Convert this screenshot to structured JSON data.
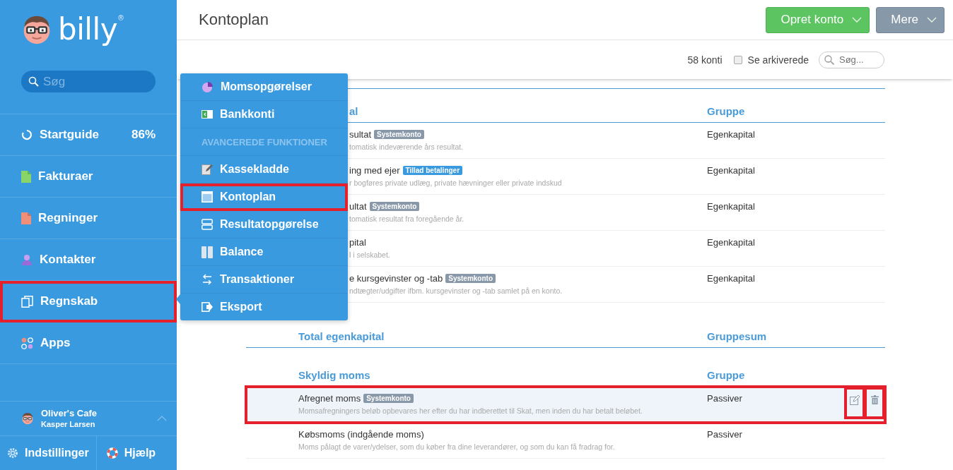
{
  "sidebar": {
    "logo": "billy",
    "logo_mark": "®",
    "search": {
      "placeholder": "Søg"
    },
    "items": [
      {
        "label": "Startguide",
        "badge": "86%",
        "highlighted": false
      },
      {
        "label": "Fakturaer",
        "highlighted": false
      },
      {
        "label": "Regninger",
        "highlighted": false
      },
      {
        "label": "Kontakter",
        "highlighted": false
      },
      {
        "label": "Regnskab",
        "highlighted": true
      },
      {
        "label": "Apps",
        "highlighted": false
      }
    ],
    "company": {
      "name": "Oliver's Cafe",
      "user": "Kasper Larsen"
    },
    "footer": [
      {
        "label": "Indstillinger"
      },
      {
        "label": "Hjælp"
      }
    ]
  },
  "flyout": {
    "items": [
      {
        "kind": "link",
        "label": "Momsopgørelser",
        "highlighted": false
      },
      {
        "kind": "link",
        "label": "Bankkonti",
        "highlighted": false
      },
      {
        "kind": "header",
        "label": "AVANCEREDE FUNKTIONER",
        "highlighted": false
      },
      {
        "kind": "link",
        "label": "Kassekladde",
        "highlighted": false
      },
      {
        "kind": "link",
        "label": "Kontoplan",
        "highlighted": true
      },
      {
        "kind": "link",
        "label": "Resultatopgørelse",
        "highlighted": false
      },
      {
        "kind": "link",
        "label": "Balance",
        "highlighted": false
      },
      {
        "kind": "link",
        "label": "Transaktioner",
        "highlighted": false
      },
      {
        "kind": "link",
        "label": "Eksport",
        "highlighted": false
      }
    ]
  },
  "header": {
    "title": "Kontoplan",
    "buttons": [
      {
        "label": "Opret konto",
        "kind": "primary"
      },
      {
        "label": "Mere",
        "kind": "secondary"
      }
    ]
  },
  "toolbar": {
    "count": "58 konti",
    "archived": {
      "label": "Se arkiverede",
      "checked": false
    },
    "search": {
      "placeholder": "Søg..."
    }
  },
  "sections": [
    {
      "kind": "group",
      "title": "al",
      "group_heading": "Gruppe",
      "rows": [
        {
          "name": "sultat",
          "tag": {
            "label": "Systemkonto",
            "kind": "system"
          },
          "description": "tomatisk indeværende års resultat.",
          "group": "Egenkapital",
          "hovered": false,
          "highlighted": false
        },
        {
          "name": "ing med ejer",
          "tag": {
            "label": "Tillad betalinger",
            "kind": "payment"
          },
          "description": "r bogføres private udlæg, private hævninger eller private indskud",
          "group": "Egenkapital",
          "hovered": false,
          "highlighted": false
        },
        {
          "name": "ultat",
          "tag": {
            "label": "Systemkonto",
            "kind": "system"
          },
          "description": "tomatisk resultat fra foregående år.",
          "group": "Egenkapital",
          "hovered": false,
          "highlighted": false
        },
        {
          "name": "pital",
          "description": "l i selskabet.",
          "group": "Egenkapital",
          "hovered": false,
          "highlighted": false
        },
        {
          "name": "e kursgevinster og -tab",
          "tag": {
            "label": "Systemkonto",
            "kind": "system"
          },
          "description": "ndtægter/udgifter ifbm. kursgevinster og -tab samlet på en konto.",
          "group": "Egenkapital",
          "hovered": false,
          "highlighted": false
        }
      ]
    },
    {
      "kind": "total",
      "title": "Total egenkapital",
      "group_heading": "Gruppesum"
    },
    {
      "kind": "group",
      "title": "Skyldig moms",
      "group_heading": "Gruppe",
      "rows": [
        {
          "name": "Afregnet moms",
          "tag": {
            "label": "Systemkonto",
            "kind": "system"
          },
          "description": "Momsafregningers beløb opbevares her efter du har indberettet til Skat, men inden du har betalt beløbet.",
          "group": "Passiver",
          "hovered": true,
          "highlighted": true,
          "actions": [
            {
              "kind": "edit",
              "highlighted": true
            },
            {
              "kind": "delete",
              "highlighted": true
            }
          ]
        },
        {
          "name": "Købsmoms (indgående moms)",
          "description": "Moms pålagt de varer/ydelser, som du køber fra dine leverandører, og som du kan få fradrag for.",
          "group": "Passiver",
          "hovered": false,
          "highlighted": false
        }
      ]
    }
  ]
}
